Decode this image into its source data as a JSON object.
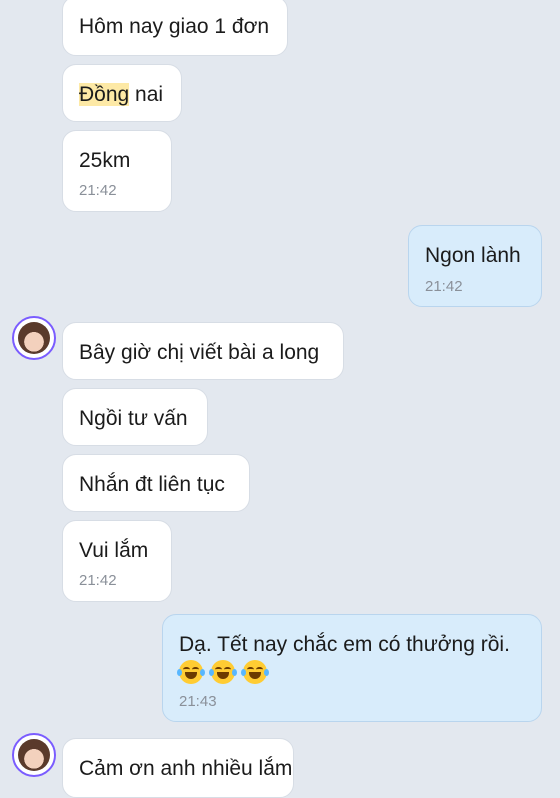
{
  "messages": [
    {
      "text_before": "",
      "highlight": "",
      "text": "Hôm nay giao 1 đơn",
      "time": ""
    },
    {
      "text_before": "",
      "highlight": "Đồng",
      "text": " nai",
      "time": ""
    },
    {
      "text_before": "",
      "highlight": "",
      "text": "25km",
      "time": "21:42"
    },
    {
      "text_before": "",
      "highlight": "",
      "text": "Ngon lành",
      "time": "21:42"
    },
    {
      "text_before": "",
      "highlight": "",
      "text": "Bây giờ chị viết bài a long",
      "time": ""
    },
    {
      "text_before": "",
      "highlight": "",
      "text": "Ngồi tư vấn",
      "time": ""
    },
    {
      "text_before": "",
      "highlight": "",
      "text": "Nhắn đt liên tục",
      "time": ""
    },
    {
      "text_before": "",
      "highlight": "",
      "text": "Vui lắm",
      "time": "21:42"
    },
    {
      "text_before": "",
      "highlight": "",
      "text": "Dạ. Tết nay chắc em có thưởng rồi.",
      "time": "21:43"
    },
    {
      "text_before": "",
      "highlight": "",
      "text": "Cảm ơn anh nhiều lắm",
      "time": ""
    }
  ],
  "emojis": [
    "face-with-tears-of-joy",
    "face-with-tears-of-joy",
    "face-with-tears-of-joy"
  ],
  "colors": {
    "background": "#e3e8ef",
    "incoming_bubble": "#ffffff",
    "outgoing_bubble": "#d8ecfb",
    "highlight": "#fde9a6",
    "avatar_ring": "#7a5cff"
  }
}
